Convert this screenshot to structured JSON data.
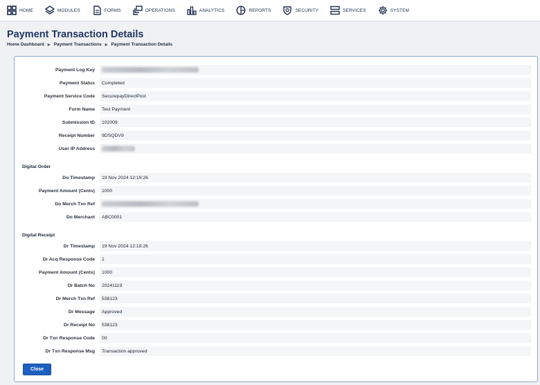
{
  "nav": [
    {
      "label": "HOME",
      "icon": "home-grid-icon"
    },
    {
      "label": "MODULES",
      "icon": "modules-icon"
    },
    {
      "label": "FORMS",
      "icon": "forms-icon"
    },
    {
      "label": "OPERATIONS",
      "icon": "operations-icon"
    },
    {
      "label": "ANALYTICS",
      "icon": "analytics-icon"
    },
    {
      "label": "REPORTS",
      "icon": "reports-icon"
    },
    {
      "label": "SECURITY",
      "icon": "security-icon"
    },
    {
      "label": "SERVICES",
      "icon": "services-icon"
    },
    {
      "label": "SYSTEM",
      "icon": "system-gear-icon"
    }
  ],
  "page": {
    "title": "Payment Transaction Details",
    "breadcrumb": [
      "Home Dashboard",
      "Payment Transactions",
      "Payment Transaction Details"
    ]
  },
  "details": [
    {
      "label": "Payment Log Key",
      "value": "",
      "redacted": true
    },
    {
      "label": "Payment Status",
      "value": "Completed"
    },
    {
      "label": "Payment Service Code",
      "value": "SecurepayDirectPost"
    },
    {
      "label": "Form Name",
      "value": "Test Payment"
    },
    {
      "label": "Submission ID",
      "value": "102009"
    },
    {
      "label": "Receipt Number",
      "value": "9DSQDV9"
    },
    {
      "label": "User IP Address",
      "value": "",
      "redacted": true
    }
  ],
  "digital_order": {
    "heading": "Digital Order",
    "rows": [
      {
        "label": "Do Timestamp",
        "value": "19 Nov 2024 12:19:26"
      },
      {
        "label": "Payment Amount (Cents)",
        "value": "1000"
      },
      {
        "label": "Do Merch Txn Ref",
        "value": "",
        "redacted": true
      },
      {
        "label": "Do Merchant",
        "value": "ABC0001"
      }
    ]
  },
  "digital_receipt": {
    "heading": "Digital Receipt",
    "rows": [
      {
        "label": "Dr Timestamp",
        "value": "19 Nov 2024 12:19:26"
      },
      {
        "label": "Dr Acq Response Code",
        "value": "1"
      },
      {
        "label": "Payment Amount (Cents)",
        "value": "1000"
      },
      {
        "label": "Dr Batch No",
        "value": "20241119"
      },
      {
        "label": "Dr Merch Txn Ref",
        "value": "538123"
      },
      {
        "label": "Dr Message",
        "value": "Approved"
      },
      {
        "label": "Dr Receipt No",
        "value": "538123"
      },
      {
        "label": "Dr Txn Response Code",
        "value": "00"
      },
      {
        "label": "Dr Txn Response Msg",
        "value": "Transaction approved"
      }
    ]
  },
  "actions": {
    "close_label": "Close"
  },
  "colors": {
    "title": "#1f3563",
    "button": "#1d5fbf",
    "panel_border": "#8ea6d0",
    "nav_text": "#1b2a4e"
  }
}
